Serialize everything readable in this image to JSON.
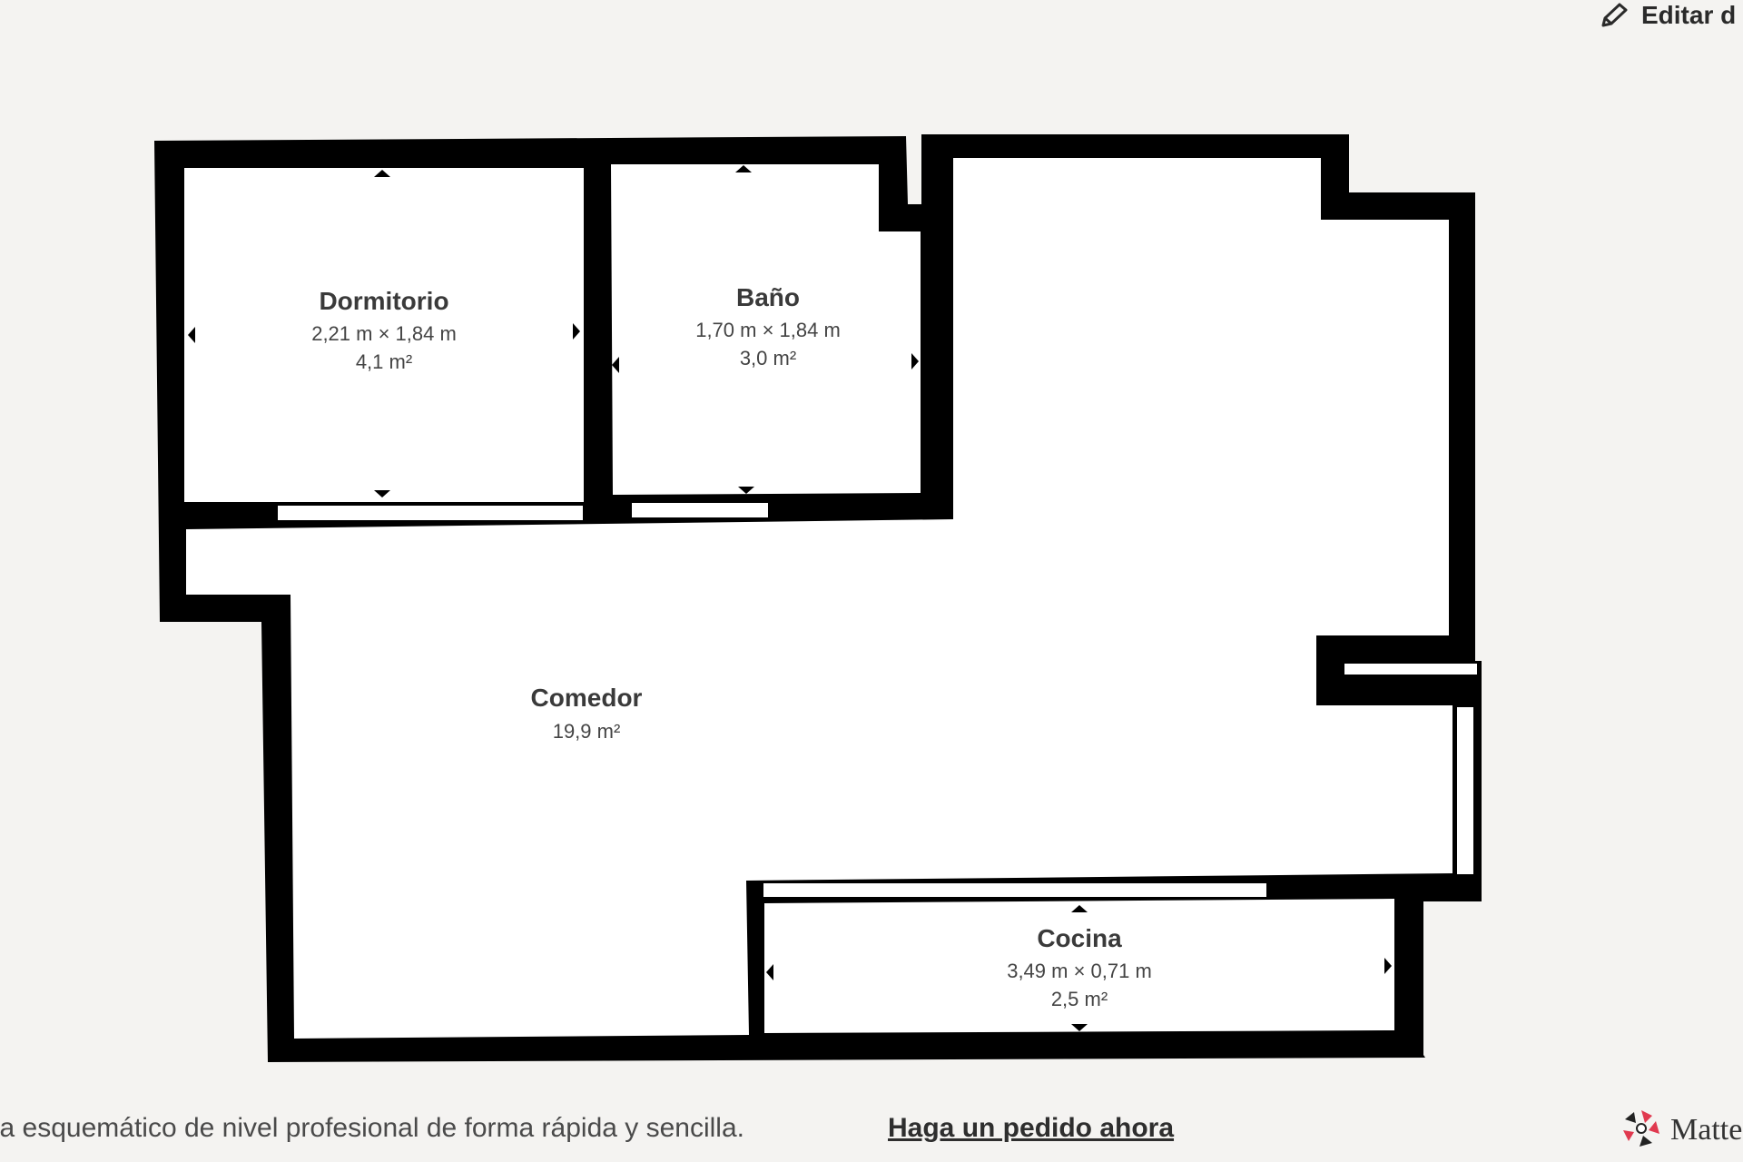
{
  "toolbar": {
    "edit_label": "Editar d",
    "edit_icon": "pencil-icon"
  },
  "rooms": [
    {
      "name": "Dormitorio",
      "dimensions": "2,21 m × 1,84 m",
      "area": "4,1 m²"
    },
    {
      "name": "Baño",
      "dimensions": "1,70 m × 1,84 m",
      "area": "3,0 m²"
    },
    {
      "name": "Comedor",
      "dimensions": "",
      "area": "19,9 m²"
    },
    {
      "name": "Cocina",
      "dimensions": "3,49 m × 0,71 m",
      "area": "2,5 m²"
    }
  ],
  "footer": {
    "text": "o de planta esquemático de nivel profesional de forma rápida y sencilla.",
    "link": "Haga un pedido ahora"
  },
  "brand": {
    "name": "Matte",
    "logo_icon": "matterport-logo-icon",
    "accent": "#e0394f"
  },
  "colors": {
    "background": "#f4f3f1",
    "wall": "#000000",
    "floor": "#ffffff"
  }
}
